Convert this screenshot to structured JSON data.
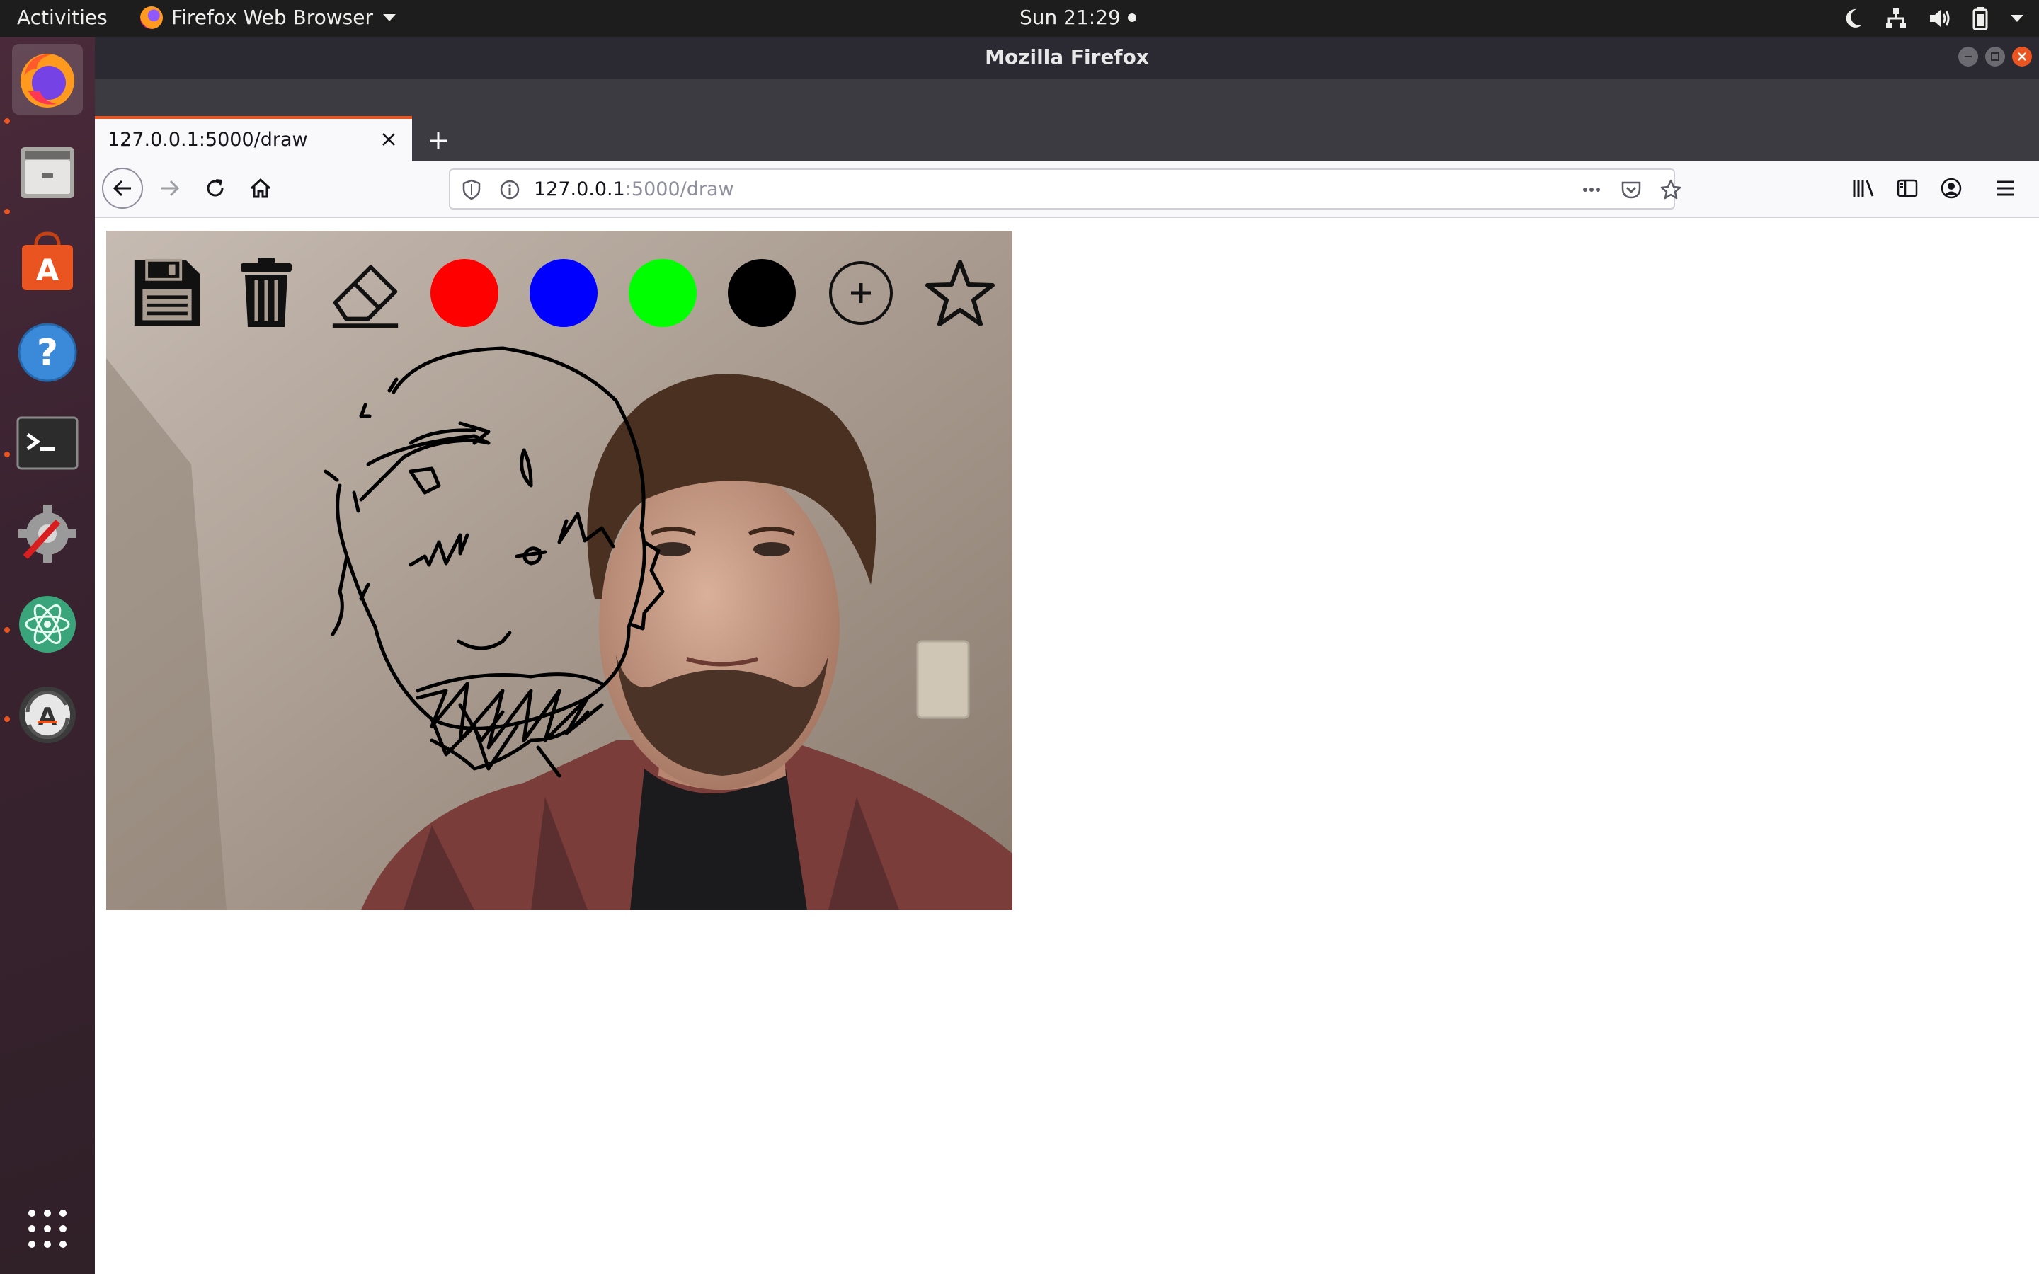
{
  "topbar": {
    "activities": "Activities",
    "app_name": "Firefox Web Browser",
    "clock": "Sun 21:29"
  },
  "dock": {
    "items": [
      {
        "name": "firefox",
        "icon": "firefox-icon",
        "running": true,
        "active": true
      },
      {
        "name": "files",
        "icon": "files-icon",
        "running": true
      },
      {
        "name": "software",
        "icon": "software-center-icon",
        "running": false
      },
      {
        "name": "help",
        "icon": "help-icon",
        "running": false
      },
      {
        "name": "terminal",
        "icon": "terminal-icon",
        "running": true
      },
      {
        "name": "settings",
        "icon": "settings-icon",
        "running": false
      },
      {
        "name": "atom",
        "icon": "atom-icon",
        "running": true
      },
      {
        "name": "updater",
        "icon": "software-updater-icon",
        "running": true
      }
    ]
  },
  "window": {
    "title": "Mozilla Firefox"
  },
  "tab": {
    "label": "127.0.0.1:5000/draw"
  },
  "urlbar": {
    "host": "127.0.0.1",
    "path": ":5000/draw"
  },
  "drawing_app": {
    "tools": [
      {
        "name": "save",
        "icon": "floppy-disk-icon"
      },
      {
        "name": "clear",
        "icon": "trash-icon"
      },
      {
        "name": "eraser",
        "icon": "eraser-icon"
      }
    ],
    "colors": [
      {
        "name": "red",
        "hex": "#ff0000"
      },
      {
        "name": "blue",
        "hex": "#0000ff"
      },
      {
        "name": "green",
        "hex": "#00ff00"
      },
      {
        "name": "black",
        "hex": "#000000"
      }
    ],
    "extra_tools": [
      {
        "name": "add",
        "icon": "plus-circle-icon"
      },
      {
        "name": "favorite",
        "icon": "star-icon"
      }
    ]
  },
  "colors": {
    "accent": "#e95420",
    "topbar_bg": "#1d1d1d",
    "tabstrip_bg": "#3c3b41"
  }
}
